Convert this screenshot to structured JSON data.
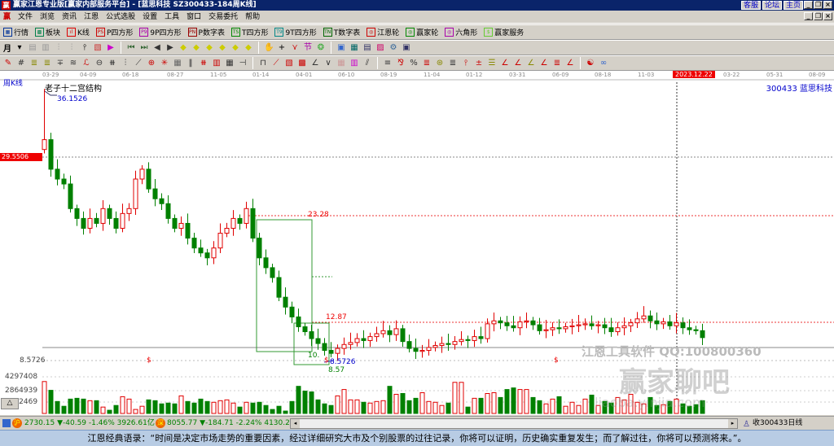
{
  "window": {
    "title": "赢家江恩专业版[赢家内部服务平台] - [蓝思科技   SZ300433-184周K线]",
    "links": [
      "客服",
      "论坛",
      "主页"
    ],
    "logo": "赢"
  },
  "menu": [
    "文件",
    "浏览",
    "资讯",
    "江恩",
    "公式选股",
    "设置",
    "工具",
    "窗口",
    "交易委托",
    "帮助"
  ],
  "toolbar1": [
    {
      "icon": "market-icon",
      "glyph": "▦",
      "color": "#003399",
      "label": "行情"
    },
    {
      "icon": "sector-icon",
      "glyph": "▩",
      "color": "#00804a",
      "label": "板块"
    },
    {
      "icon": "kline-icon",
      "glyph": "ıl",
      "color": "#d00",
      "label": "K线"
    },
    {
      "icon": "p-square-icon",
      "glyph": "PS",
      "color": "#c00",
      "label": "P四方形"
    },
    {
      "icon": "p9-square-icon",
      "glyph": "P9",
      "color": "#a0a",
      "label": "9P四方形"
    },
    {
      "icon": "p-number-icon",
      "glyph": "PN",
      "color": "#900",
      "label": "P数字表"
    },
    {
      "icon": "t-square-icon",
      "glyph": "TS",
      "color": "#080",
      "label": "T四方形"
    },
    {
      "icon": "t9-square-icon",
      "glyph": "T9",
      "color": "#088",
      "label": "9T四方形"
    },
    {
      "icon": "t-number-icon",
      "glyph": "TN",
      "color": "#060",
      "label": "T数字表"
    },
    {
      "icon": "gann-wheel-icon",
      "glyph": "◎",
      "color": "#c00",
      "label": "江恩轮"
    },
    {
      "icon": "winner-wheel-icon",
      "glyph": "◎",
      "color": "#080",
      "label": "赢家轮"
    },
    {
      "icon": "hexagon-icon",
      "glyph": "◎",
      "color": "#a0a",
      "label": "六角形"
    },
    {
      "icon": "service-icon",
      "glyph": "$",
      "color": "#6c3",
      "label": "赢家服务"
    }
  ],
  "toolbar2_period": "月",
  "chart": {
    "period_label": "周K线",
    "title": "老子十二宫结构",
    "stock": "300433 蓝思科技",
    "dates": [
      "03-29",
      "04-09",
      "06-18",
      "08-27",
      "11-05",
      "01-14",
      "04-01",
      "06-10",
      "08-19",
      "11-04",
      "01-12",
      "03-31",
      "06-09",
      "08-18",
      "11-03",
      "2023.12.22",
      "03-22",
      "05-31",
      "08-09"
    ],
    "cursor_price": "29.5506",
    "high_label": "36.1526",
    "low_axis_label": "8.5726",
    "levels": {
      "upper": "23.28",
      "middle": "12.87",
      "box_low": "10.",
      "low_blue": "8.5726",
      "low_green": "8.57"
    },
    "marker": "$",
    "vol_ticks": [
      "4297408",
      "2864939",
      "1432469"
    ],
    "watermark": "江恩工具软件  QQ:100800360",
    "watermark2": "赢家聊吧",
    "watermark3": "liaoba.yinjia.com",
    "up_color": "#e00000",
    "down_color": "#008000"
  },
  "chart_data": {
    "type": "candlestick",
    "ylim": [
      8,
      37
    ],
    "closes": [
      31,
      28,
      27,
      26.5,
      24,
      23,
      22,
      23,
      22.5,
      24,
      23,
      22,
      23.5,
      24,
      27,
      28,
      26,
      25,
      24.5,
      23,
      22,
      22.5,
      21,
      20,
      19.5,
      19,
      20,
      21.5,
      22,
      23,
      22.5,
      24,
      21,
      19,
      18,
      17,
      15,
      14,
      13,
      12,
      11.5,
      10.8,
      10.3,
      9.6,
      9.3,
      9.8,
      10.2,
      10.4,
      10.8,
      10.6,
      11,
      11.3,
      11.6,
      11.2,
      11.8,
      10.5,
      9.8,
      9.5,
      9.6,
      9.9,
      10.1,
      10.3,
      10.2,
      10.5,
      10.7,
      10.6,
      11,
      10.8,
      12.3,
      12.6,
      12.4,
      12.1,
      11.9,
      12.5,
      12.6,
      12.2,
      11.6,
      11.7,
      11.9,
      11.8,
      12,
      12.1,
      12.2,
      12.3,
      12.1,
      12.2,
      11.9,
      11.5,
      11.9,
      12.1,
      12.4,
      12.8,
      13.1,
      12.6,
      12.3,
      12.5,
      12.1,
      12.4,
      11.9,
      11.7,
      11.6,
      10.9
    ],
    "first_open": 30,
    "volumes": [
      4.0,
      2.9,
      1.5,
      0.9,
      1.8,
      1.9,
      1.8,
      1.6,
      1.6,
      0.8,
      0.4,
      1.0,
      2.1,
      1.8,
      0.5,
      0.9,
      1.7,
      1.6,
      1.2,
      1.3,
      1.2,
      2.2,
      1.5,
      1.3,
      1.8,
      1.5,
      1.4,
      1.6,
      1.7,
      1.3,
      0.8,
      1.4,
      1.3,
      1.4,
      1.0,
      0.5,
      0.9,
      0.3,
      1.5,
      3.4,
      2.8,
      2.7,
      1.7,
      1.2,
      1.0,
      2.2,
      3.0,
      1.7,
      1.7,
      1.4,
      1.3,
      1.5,
      1.6,
      3.4,
      2.4,
      2.5,
      1.6,
      1.9,
      2.6,
      1.5,
      1.4,
      1.0,
      1.3,
      3.9,
      3.9,
      0.8,
      1.9,
      1.9,
      2.5,
      2.6,
      2.0,
      3.0,
      3.2,
      3.0,
      3.0,
      2.0,
      1.6,
      1.2,
      1.8,
      2.1,
      0.9,
      1.4,
      1.0,
      1.8,
      2.3,
      1.0,
      1.5,
      1.3,
      2.0,
      1.7,
      2.4,
      1.4,
      1.2,
      2.0,
      1.0,
      1.1,
      1.5,
      1.8,
      1.2,
      0.9,
      1.1,
      1.6
    ]
  },
  "status": {
    "sh_badge": "沪",
    "sh": "2730.15",
    "sh_chg": "▼-40.59",
    "sh_pct": "-1.46%",
    "sh_amt": "3926.61亿",
    "sz_badge": "深",
    "sz": "8055.77",
    "sz_chg": "▼-184.71",
    "sz_pct": "-2.24%",
    "sz_amt": "4130.2",
    "right": "收300433日线"
  },
  "quote": "江恩经典语录：“时间是决定市场走势的重要因素，经过详细研究大市及个别股票的过往记录，你将可以证明，历史确实重复发生；而了解过往，你将可以预测将来。”。"
}
